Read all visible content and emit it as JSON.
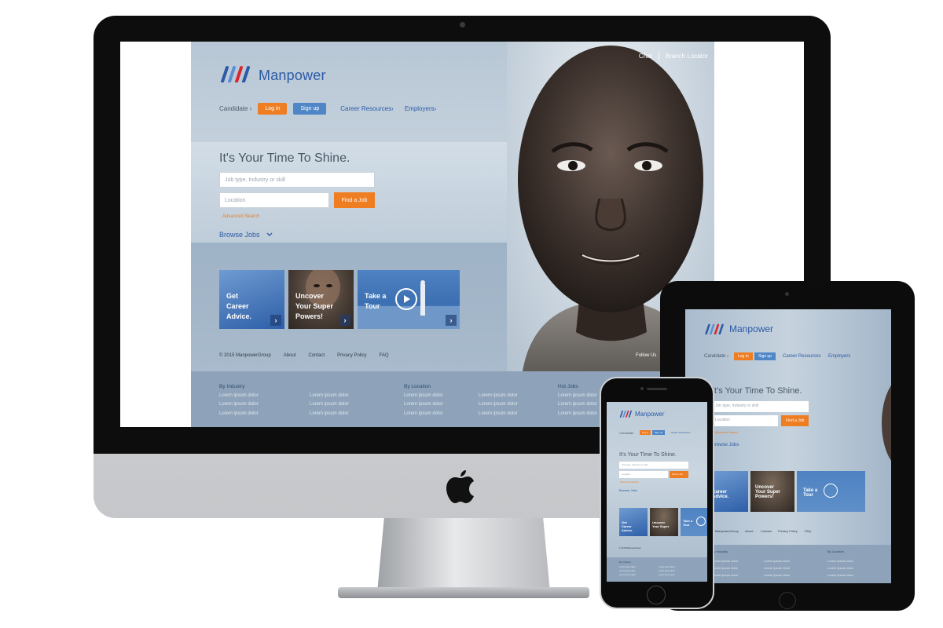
{
  "brand": {
    "name": "Manpower",
    "orange": "#ef7d22",
    "blue": "#2b5aa6",
    "button_blue": "#4f86c6"
  },
  "top_links": {
    "chat": "Chat",
    "branch_locator": "Branch Locator"
  },
  "nav": {
    "candidate": "Candidate",
    "login": "Log in",
    "signup": "Sign up",
    "career_resources": "Career Resources",
    "employers": "Employers",
    "chevron": "›"
  },
  "hero": {
    "headline": "It's Your Time To Shine.",
    "job_placeholder": "Job type, Industry or skill",
    "location_placeholder": "Location",
    "find_button": "Find a Job",
    "advanced_search": "Advanced Search",
    "browse_jobs": "Browse Jobs"
  },
  "tiles": [
    {
      "line1": "Get",
      "line2": "Career",
      "line3": "Advice.",
      "arrow": "›"
    },
    {
      "line1": "Uncover",
      "line2": "Your Super",
      "line3": "Powers!",
      "arrow": "›"
    },
    {
      "line1": "Take a",
      "line2": "Tour",
      "arrow": "›",
      "icon": "play-icon"
    }
  ],
  "footer": {
    "copyright": "© 2015 ManpowerGroup",
    "about": "About",
    "contact": "Contact",
    "privacy": "Privacy Policy",
    "faq": "FAQ",
    "follow": "Follow Us"
  },
  "sitemap": {
    "by_industry": "By Industry",
    "by_location": "By Location",
    "hot_jobs": "Hot Jobs",
    "item": "Lorem ipsum dolor"
  },
  "ipad_footer": {
    "group": "ManpowerGroup",
    "about": "About",
    "contact": "Contact",
    "privacy": "Privacy Policy",
    "faq": "FAQ",
    "by_industry": "By Industry",
    "by_location": "By Location"
  }
}
